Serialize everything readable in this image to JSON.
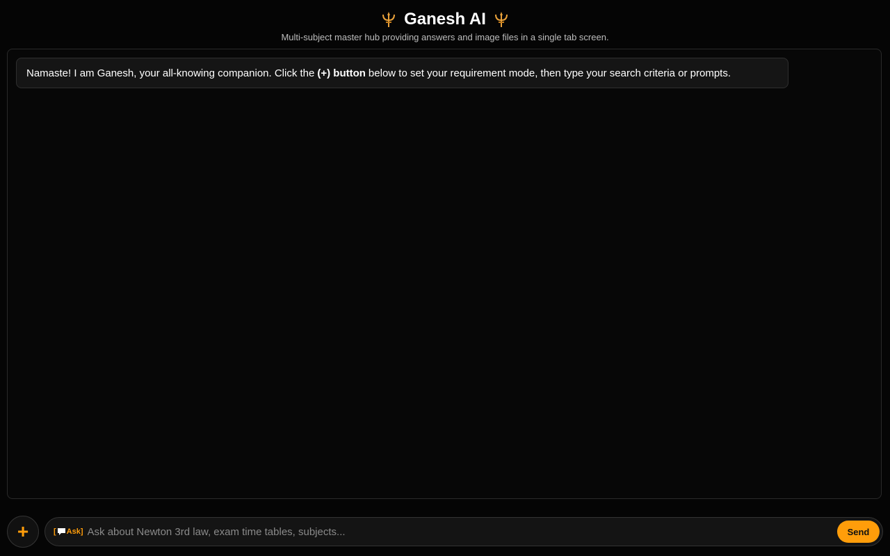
{
  "header": {
    "title": "Ganesh AI",
    "subtitle": "Multi-subject master hub providing answers and image files in a single tab screen.",
    "icon_left": "trident-icon",
    "icon_right": "trident-icon"
  },
  "chat": {
    "welcome": {
      "text_before": "Namaste! I am Ganesh, your all-knowing companion. Click the",
      "bold": "(+) button",
      "text_after": "below to set your requirement mode, then type your search criteria or prompts."
    }
  },
  "composer": {
    "plus_label": "+",
    "mode_open": "[",
    "mode_icon": "speech-bubble-icon",
    "mode_label": "Ask]",
    "input_value": "",
    "placeholder": "Ask about Newton 3rd law, exam time tables, subjects...",
    "send_label": "Send"
  },
  "colors": {
    "accent": "#ff9d0a",
    "background": "#050505",
    "panel": "#070707",
    "bubble": "#151515"
  }
}
